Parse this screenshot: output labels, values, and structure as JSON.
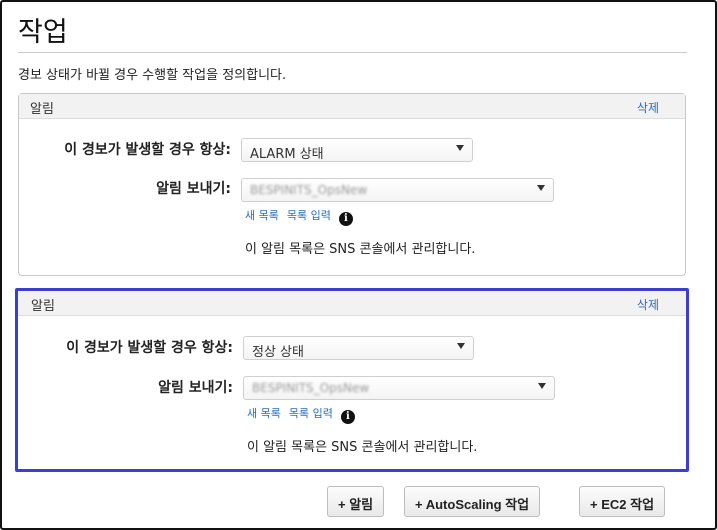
{
  "page": {
    "title": "작업",
    "subtitle": "경보 상태가 바뀔 경우 수행할 작업을 정의합니다."
  },
  "notifications": [
    {
      "header": "알림",
      "delete_label": "삭제",
      "condition_label": "이 경보가 발생할 경우 항상:",
      "condition_value": "ALARM 상태",
      "send_label": "알림 보내기:",
      "send_value": "BESPINITS_OpsNew",
      "new_list_link": "새 목록",
      "enter_list_link": "목록 입력",
      "info_icon": "info-icon",
      "note": "이 알림 목록은 SNS 콘솔에서 관리합니다."
    },
    {
      "header": "알림",
      "delete_label": "삭제",
      "condition_label": "이 경보가 발생할 경우 항상:",
      "condition_value": "정상 상태",
      "send_label": "알림 보내기:",
      "send_value": "BESPINITS_OpsNew",
      "new_list_link": "새 목록",
      "enter_list_link": "목록 입력",
      "info_icon": "info-icon",
      "note": "이 알림 목록은 SNS 콘솔에서 관리합니다."
    }
  ],
  "buttons": {
    "add_notification": "+ 알림",
    "add_autoscaling": "+ AutoScaling 작업",
    "add_ec2": "+ EC2 작업"
  },
  "colors": {
    "selected_border": "#3b3fd0",
    "link": "#2a6ebb"
  }
}
